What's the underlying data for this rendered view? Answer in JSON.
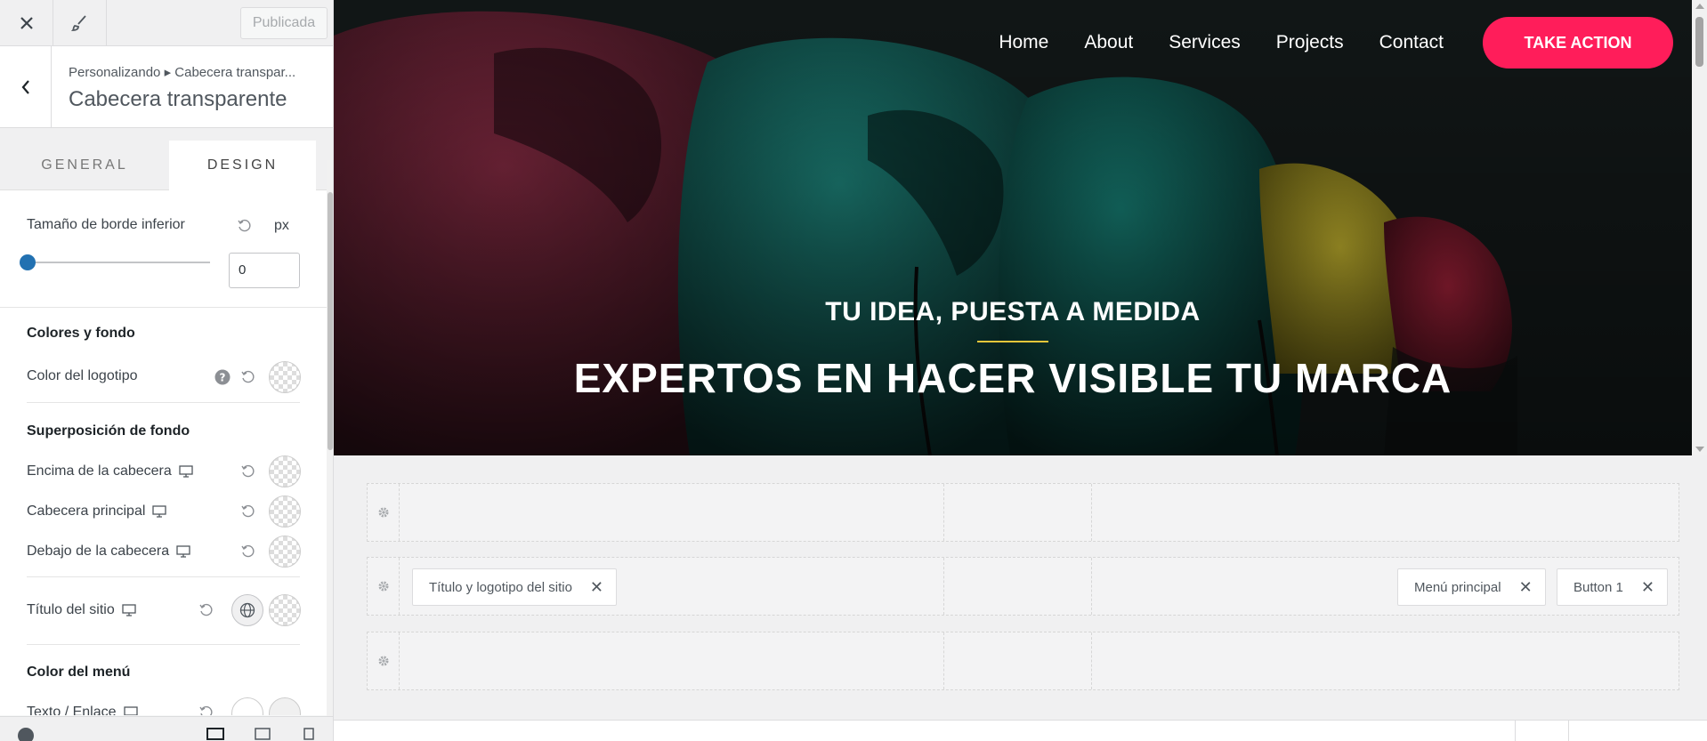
{
  "topbar": {
    "close_icon": "close-icon",
    "brush_icon": "brush-icon",
    "publish_label": "Publicada"
  },
  "section": {
    "breadcrumb": "Personalizando ▸ Cabecera transpar...",
    "title": "Cabecera transparente"
  },
  "tabs": [
    {
      "label": "GENERAL"
    },
    {
      "label": "DESIGN"
    }
  ],
  "panel": {
    "border_size_label": "Tamaño de borde inferior",
    "unit": "px",
    "border_size_value": "0",
    "colors_heading": "Colores y fondo",
    "logo_color_label": "Color del logotipo",
    "overlay_heading": "Superposición de fondo",
    "above_header_label": "Encima de la cabecera",
    "main_header_label": "Cabecera principal",
    "below_header_label": "Debajo de la cabecera",
    "site_title_label": "Título del sitio",
    "menu_color_heading": "Color del menú",
    "text_link_label": "Texto / Enlace"
  },
  "preview": {
    "nav": [
      "Home",
      "About",
      "Services",
      "Projects",
      "Contact"
    ],
    "cta": "TAKE ACTION",
    "hero_subtitle": "TU IDEA, PUESTA A MEDIDA",
    "hero_title": "EXPERTOS EN HACER VISIBLE TU MARCA"
  },
  "builder": {
    "site_title_item": "Título y logotipo del sitio",
    "menu_item": "Menú principal",
    "button_item": "Button 1"
  },
  "colors": {
    "accent": "#ff1d5a",
    "slider": "#2271b1",
    "underline": "#e8c63a"
  }
}
